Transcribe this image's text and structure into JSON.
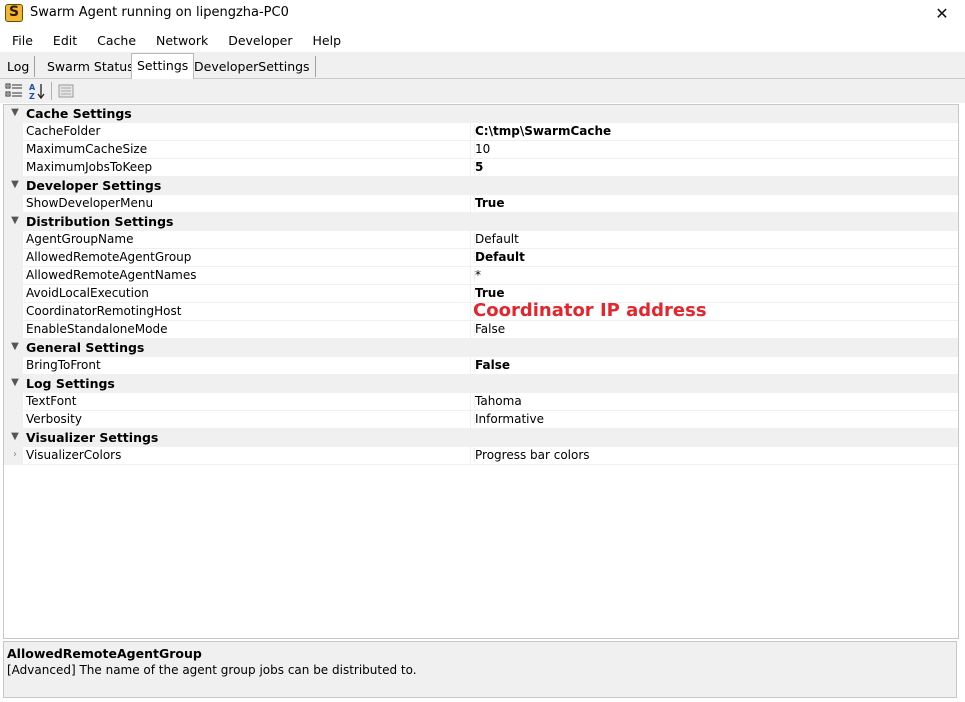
{
  "window": {
    "title": "Swarm Agent running on lipengzha-PC0",
    "close_glyph": "✕"
  },
  "menubar": {
    "items": [
      "File",
      "Edit",
      "Cache",
      "Network",
      "Developer",
      "Help"
    ]
  },
  "tabs": [
    {
      "label": "Log",
      "active": false
    },
    {
      "label": "Swarm Status",
      "active": false
    },
    {
      "label": "Settings",
      "active": true
    },
    {
      "label": "DeveloperSettings",
      "active": false
    }
  ],
  "toolbar": {
    "icons": [
      "categorized-icon",
      "alphabetical-icon",
      "property-pages-icon"
    ]
  },
  "grid": {
    "rows": [
      {
        "type": "category",
        "label": "Cache Settings"
      },
      {
        "type": "prop",
        "label": "CacheFolder",
        "value": "C:\\tmp\\SwarmCache",
        "bold": true
      },
      {
        "type": "prop",
        "label": "MaximumCacheSize",
        "value": "10",
        "bold": false
      },
      {
        "type": "prop",
        "label": "MaximumJobsToKeep",
        "value": "5",
        "bold": true
      },
      {
        "type": "category",
        "label": "Developer Settings"
      },
      {
        "type": "prop",
        "label": "ShowDeveloperMenu",
        "value": "True",
        "bold": true
      },
      {
        "type": "category",
        "label": "Distribution Settings"
      },
      {
        "type": "prop",
        "label": "AgentGroupName",
        "value": "Default",
        "bold": false
      },
      {
        "type": "prop",
        "label": "AllowedRemoteAgentGroup",
        "value": "Default",
        "bold": true
      },
      {
        "type": "prop",
        "label": "AllowedRemoteAgentNames",
        "value": "*",
        "bold": false
      },
      {
        "type": "prop",
        "label": "AvoidLocalExecution",
        "value": "True",
        "bold": true
      },
      {
        "type": "prop",
        "label": "CoordinatorRemotingHost",
        "value": "",
        "bold": false
      },
      {
        "type": "prop",
        "label": "EnableStandaloneMode",
        "value": "False",
        "bold": false
      },
      {
        "type": "category",
        "label": "General Settings"
      },
      {
        "type": "prop",
        "label": "BringToFront",
        "value": "False",
        "bold": true
      },
      {
        "type": "category",
        "label": "Log Settings"
      },
      {
        "type": "prop",
        "label": "TextFont",
        "value": "Tahoma",
        "bold": false
      },
      {
        "type": "prop",
        "label": "Verbosity",
        "value": "Informative",
        "bold": false
      },
      {
        "type": "category",
        "label": "Visualizer Settings"
      },
      {
        "type": "prop",
        "label": "VisualizerColors",
        "value": "Progress bar colors",
        "bold": false,
        "expandable": true
      }
    ]
  },
  "annotation": {
    "text": "Coordinator IP address",
    "color": "#e3262d"
  },
  "help": {
    "title": "AllowedRemoteAgentGroup",
    "description": "[Advanced] The name of the agent group jobs can be distributed to."
  }
}
